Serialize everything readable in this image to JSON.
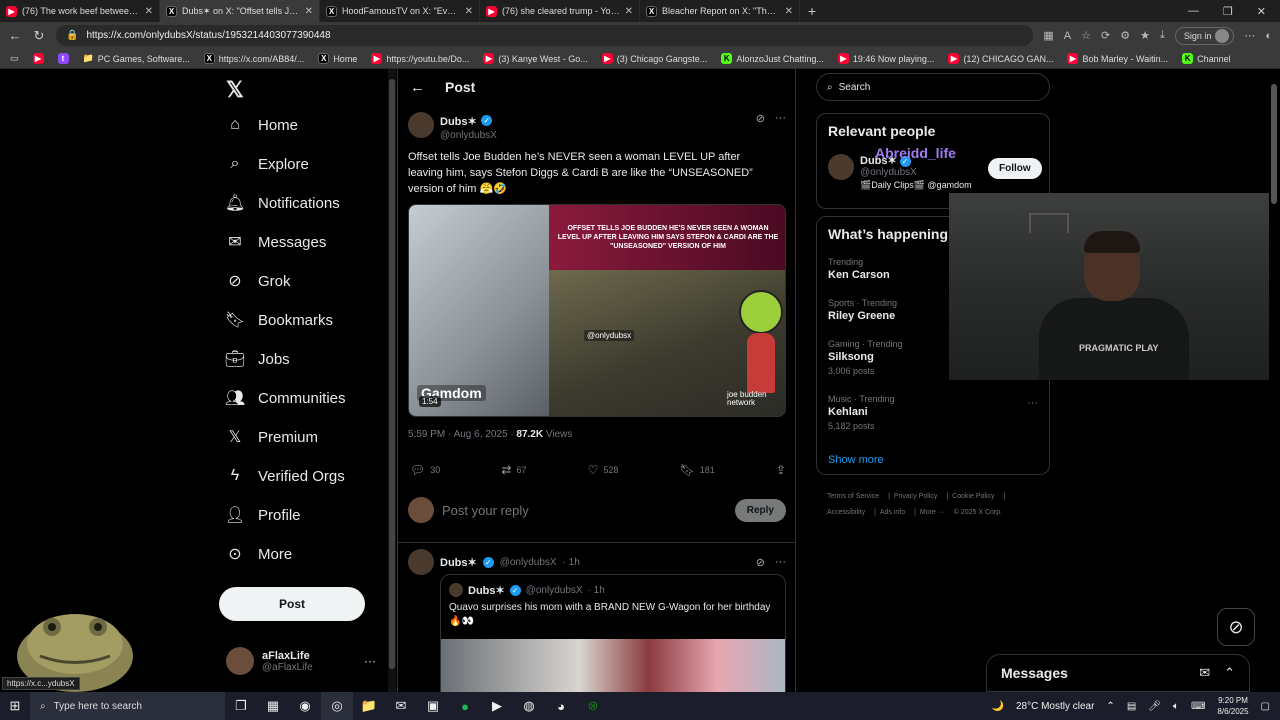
{
  "browser": {
    "tabs": [
      {
        "title": "(76) The work beef between Shaq",
        "icon": "youtube-icon"
      },
      {
        "title": "Dubs✶ on X: \"Offset tells Joe Bud",
        "icon": "x-icon",
        "active": true
      },
      {
        "title": "HoodFamousTV on X: \"Even the",
        "icon": "x-icon"
      },
      {
        "title": "(76) she cleared trump - YouTube",
        "icon": "youtube-icon"
      },
      {
        "title": "Bleacher Report on X: \"The NFL c",
        "icon": "x-icon"
      }
    ],
    "url": "https://x.com/onlydubsX/status/1953214403077390448",
    "sign_in": "Sign in",
    "bookmarks": [
      "PC Games, Software...",
      "https://x.com/AB84/...",
      "Home",
      "https://youtu.be/Do...",
      "(3) Kanye West - Go...",
      "(3) Chicago Gangste...",
      "AlonzoJust Chatting...",
      "19:46 Now playing...",
      "(12) CHICAGO GAN...",
      "Bob Marley - Waitin...",
      "Channel"
    ]
  },
  "nav": {
    "items": [
      {
        "label": "Home",
        "icon": "home-icon"
      },
      {
        "label": "Explore",
        "icon": "search-icon"
      },
      {
        "label": "Notifications",
        "icon": "bell-icon"
      },
      {
        "label": "Messages",
        "icon": "mail-icon"
      },
      {
        "label": "Grok",
        "icon": "grok-icon"
      },
      {
        "label": "Bookmarks",
        "icon": "bookmark-icon"
      },
      {
        "label": "Jobs",
        "icon": "briefcase-icon"
      },
      {
        "label": "Communities",
        "icon": "people-icon"
      },
      {
        "label": "Premium",
        "icon": "x-icon"
      },
      {
        "label": "Verified Orgs",
        "icon": "lightning-icon"
      },
      {
        "label": "Profile",
        "icon": "person-icon"
      },
      {
        "label": "More",
        "icon": "more-circle-icon"
      }
    ],
    "post_button": "Post",
    "account": {
      "name": "aFlaxLife",
      "handle": "@aFlaxLife"
    },
    "status_tooltip": "https://x.c...ydubsX"
  },
  "post": {
    "header_title": "Post",
    "author_name": "Dubs✶",
    "author_handle": "@onlydubsX",
    "text": "Offset tells Joe Budden he’s NEVER seen a woman LEVEL UP after leaving him, says Stefon Diggs & Cardi B are like the “UNSEASONED” version of him 😤🤣",
    "media": {
      "banner": "OFFSET TELLS JOE BUDDEN HE'S NEVER SEEN A WOMAN LEVEL UP AFTER LEAVING HIM SAYS STEFON & CARDI ARE THE \"UNSEASONED\" VERSION OF HIM",
      "watermark": "@onlydubsx",
      "sponsor": "Gamdom",
      "duration": "1:54",
      "network": "joe budden network"
    },
    "timestamp": "5:59 PM · Aug 6, 2025 · ",
    "views_count": "87.2K",
    "views_label": " Views",
    "actions": {
      "replies": "30",
      "reposts": "67",
      "likes": "528",
      "bookmarks": "181"
    },
    "reply_placeholder": "Post your reply",
    "reply_button": "Reply"
  },
  "reply": {
    "author_name": "Dubs✶",
    "author_handle": "@onlydubsX",
    "time": "· 1h",
    "quote": {
      "author_name": "Dubs✶",
      "author_handle": "@onlydubsX",
      "time": "· 1h",
      "text": "Quavo surprises his mom with a BRAND NEW G-Wagon for her birthday 🔥👀"
    }
  },
  "right": {
    "search_placeholder": "Search",
    "relevant_title": "Relevant people",
    "relevant_person": {
      "name": "Dubs✶",
      "handle": "@onlydubsX",
      "bio": "🎬Daily Clips🎬 @gamdom",
      "follow": "Follow"
    },
    "overlay_name": "Abreidd_life",
    "happening_title": "What’s happening",
    "trends": [
      {
        "context": "Trending",
        "topic": "Ken Carson",
        "count": ""
      },
      {
        "context": "Sports · Trending",
        "topic": "Riley Greene",
        "count": ""
      },
      {
        "context": "Gaming · Trending",
        "topic": "Silksong",
        "count": "3,006 posts"
      },
      {
        "context": "Music · Trending",
        "topic": "Kehlani",
        "count": "5,182 posts"
      }
    ],
    "show_more": "Show more",
    "footer": [
      "Terms of Service",
      "Privacy Policy",
      "Cookie Policy",
      "Accessibility",
      "Ads info",
      "More ···",
      "© 2025 X Corp."
    ],
    "webcam_logo": "PRAGMATIC PLAY"
  },
  "messages_drawer": {
    "title": "Messages"
  },
  "taskbar": {
    "search_placeholder": "Type here to search",
    "weather": "28°C  Mostly clear",
    "time": "9:20 PM",
    "date": "8/6/2025"
  }
}
